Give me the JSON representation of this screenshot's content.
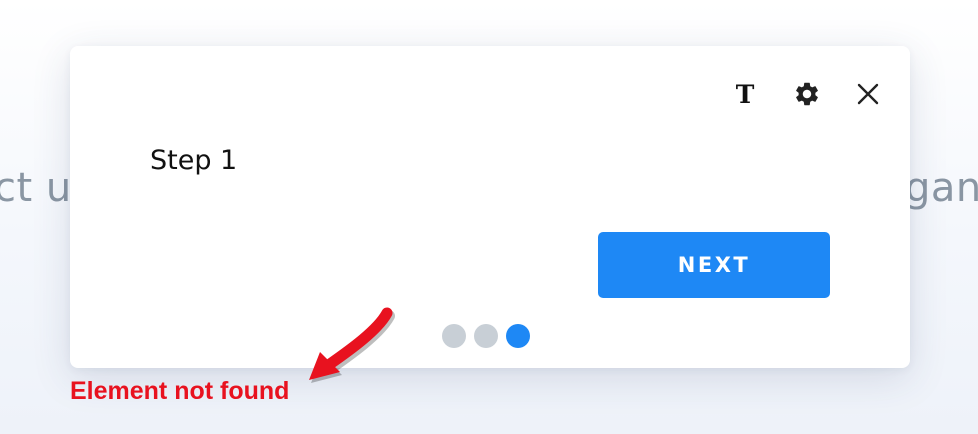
{
  "background": {
    "left_text": "ct u",
    "right_text": "gan"
  },
  "dialog": {
    "toolbar": {
      "text_size_glyph": "T",
      "text_size_icon": "text-size-icon",
      "settings_icon": "gear-icon",
      "close_icon": "close-icon"
    },
    "step_title": "Step 1",
    "next_label": "NEXT",
    "pagination": {
      "total": 3,
      "current": 3
    }
  },
  "annotation": {
    "label": "Element not found",
    "color": "#e8121f"
  },
  "colors": {
    "accent": "#1e88f5",
    "dot_inactive": "#c8cfd6",
    "error": "#e8121f"
  }
}
